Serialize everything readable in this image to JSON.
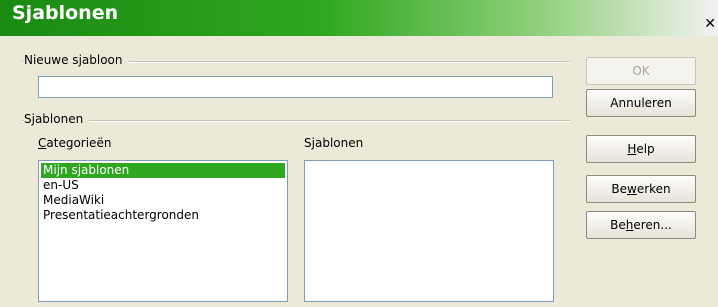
{
  "window": {
    "title": "Sjablonen",
    "close_glyph": "✕"
  },
  "new_template": {
    "group_label": "Nieuwe sjabloon",
    "value": "",
    "placeholder": ""
  },
  "templates_group": {
    "label": "Sjablonen"
  },
  "categories": {
    "label_pre": "",
    "label_ul": "C",
    "label_post": "ategorieën",
    "items": [
      "Mijn sjablonen",
      "en-US",
      "MediaWiki",
      "Presentatieachtergronden"
    ],
    "selected_index": 0
  },
  "templates_list": {
    "label_pre": "S",
    "label_ul": "j",
    "label_post": "ablonen",
    "items": []
  },
  "buttons": {
    "ok": "OK",
    "cancel": "Annuleren",
    "help_pre": "",
    "help_ul": "H",
    "help_post": "elp",
    "edit_pre": "Be",
    "edit_ul": "w",
    "edit_post": "erken",
    "manage_pre": "Be",
    "manage_ul": "h",
    "manage_post": "eren..."
  },
  "colors": {
    "title_accent": "#2fa71f",
    "selection": "#2fa71f"
  }
}
